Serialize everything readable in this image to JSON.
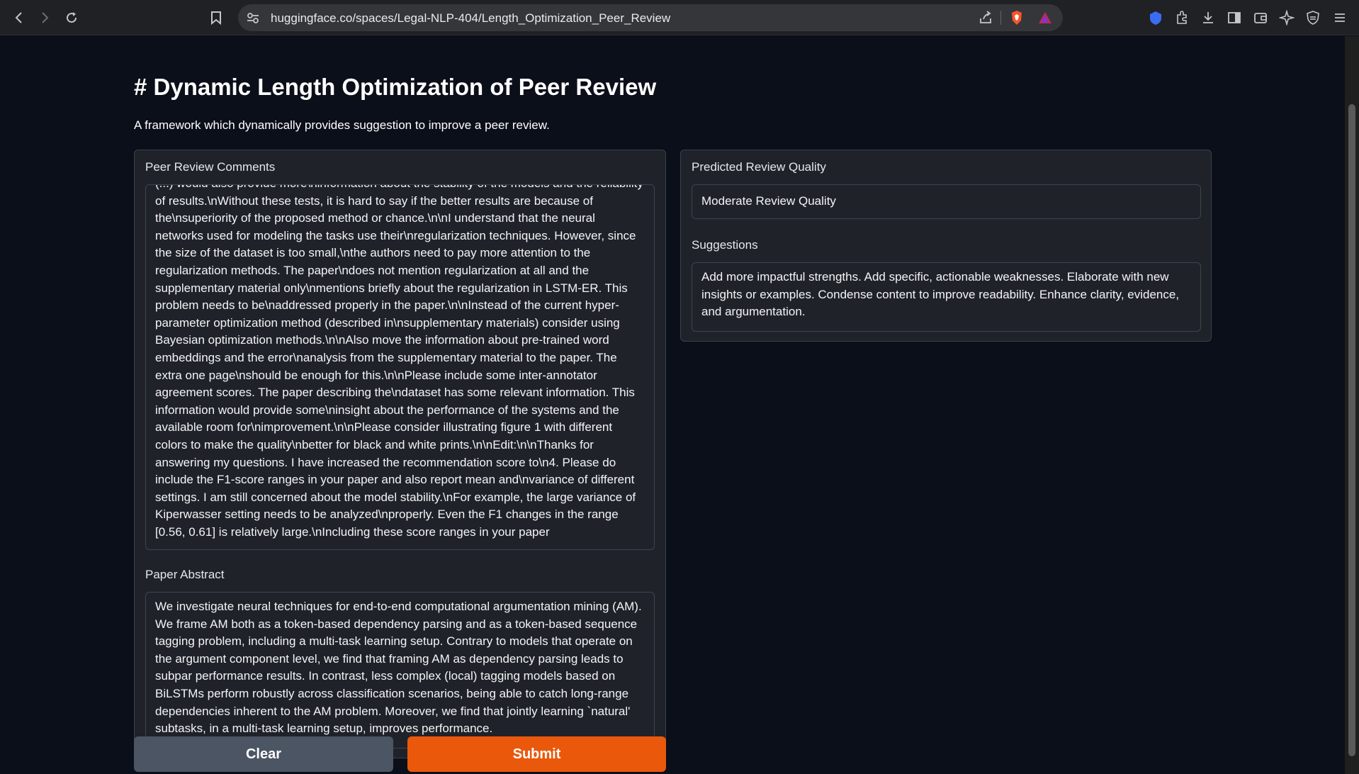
{
  "browser": {
    "url": "huggingface.co/spaces/Legal-NLP-404/Length_Optimization_Peer_Review"
  },
  "page": {
    "title": "# Dynamic Length Optimization of Peer Review",
    "subtitle": "A framework which dynamically provides suggestion to improve a peer review."
  },
  "inputs": {
    "review_label": "Peer Review Comments",
    "review_text": "(...) would also provide more\\ninformation about the stability of the models and the reliability of results.\\nWithout these tests, it is hard to say if the better results are because of the\\nsuperiority of the proposed method or chance.\\n\\nI understand that the neural networks used for modeling the tasks use their\\nregularization techniques. However, since the size of the dataset is too small,\\nthe authors need to pay more attention to the regularization methods. The paper\\ndoes not mention regularization at all and the supplementary material only\\nmentions briefly about the regularization in LSTM-ER. This problem needs to be\\naddressed properly in the paper.\\n\\nInstead of the current hyper-parameter optimization method (described in\\nsupplementary materials) consider using Bayesian optimization methods.\\n\\nAlso move the information about pre-trained word embeddings and the error\\nanalysis from the supplementary material to the paper. The extra one page\\nshould be enough for this.\\n\\nPlease include some inter-annotator agreement scores. The paper describing the\\ndataset has some relevant information. This information would provide some\\ninsight about the performance of the systems and the available room for\\nimprovement.\\n\\nPlease consider illustrating figure 1 with different colors to make the quality\\nbetter for black and white prints.\\n\\nEdit:\\n\\nThanks for answering my questions. I have increased the recommendation score to\\n4. Please do include the F1-score ranges in your paper and also report mean and\\nvariance of different settings. I am still concerned about the model stability.\\nFor example, the large variance of Kiperwasser setting needs to be analyzed\\nproperly. Even the F1 changes in the range [0.56, 0.61] is relatively large.\\nIncluding these score ranges in your paper",
    "abstract_label": "Paper Abstract",
    "abstract_text": "We investigate neural techniques for end-to-end computational argumentation mining (AM). We frame AM both as a token-based dependency parsing and as a token-based sequence tagging problem, including a multi-task learning setup. Contrary to models that operate on the argument component level, we find that framing AM as dependency parsing leads to subpar performance results. In contrast, less complex (local) tagging models based on BiLSTMs perform robustly across classification scenarios, being able to catch long-range dependencies inherent to the AM problem. Moreover, we find that jointly learning `natural' subtasks, in a multi-task learning setup, improves performance."
  },
  "outputs": {
    "quality_label": "Predicted Review Quality",
    "quality_value": "Moderate Review Quality",
    "suggestions_label": "Suggestions",
    "suggestions_text": "Add more impactful strengths. Add specific, actionable weaknesses. Elaborate with new insights or examples. Condense content to improve readability. Enhance clarity, evidence, and argumentation."
  },
  "actions": {
    "clear_label": "Clear",
    "submit_label": "Submit"
  },
  "colors": {
    "submit": "#ea580c",
    "clear": "#4b5563",
    "background": "#0b0f19"
  }
}
